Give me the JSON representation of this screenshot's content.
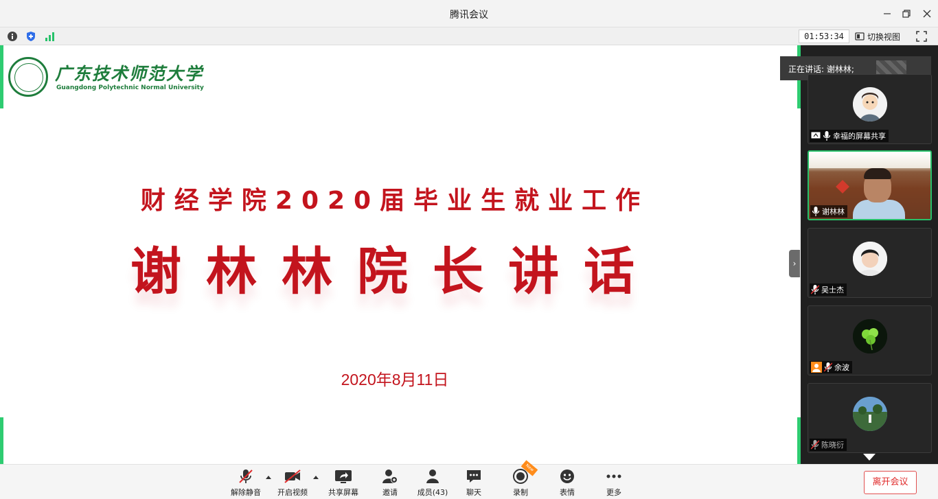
{
  "window": {
    "title": "腾讯会议"
  },
  "infobar": {
    "timer": "01:53:34",
    "switch_view_label": "切换视图"
  },
  "slide": {
    "logo_cn": "广东技术师范大学",
    "logo_en": "Guangdong Polytechnic Normal University",
    "subtitle": "财经学院2020届毕业生就业工作",
    "title": "谢林林院长讲话",
    "date": "2020年8月11日",
    "text_color": "#c3141d",
    "logo_color": "#1e7d3c"
  },
  "panel": {
    "speaking_label": "正在讲话: 谢林林;",
    "participants": [
      {
        "name": "幸福的屏幕共享",
        "muted": false,
        "sharing": true
      },
      {
        "name": "谢林林",
        "muted": false,
        "video": true
      },
      {
        "name": "吴士杰",
        "muted": true
      },
      {
        "name": "余波",
        "muted": true,
        "host_badge": true
      },
      {
        "name": "陈晓衍",
        "muted": true
      }
    ]
  },
  "toolbar": {
    "unmute_label": "解除静音",
    "video_label": "开启视频",
    "share_label": "共享屏幕",
    "invite_label": "邀请",
    "members_label": "成员(43)",
    "chat_label": "聊天",
    "record_label": "录制",
    "record_badge": "New",
    "reactions_label": "表情",
    "more_label": "更多",
    "leave_label": "离开会议"
  },
  "colors": {
    "accent_green": "#27c16a",
    "leave_red": "#e02b2b"
  }
}
